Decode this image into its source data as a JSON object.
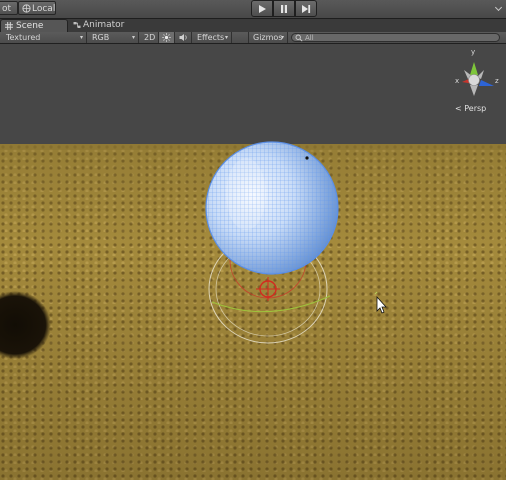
{
  "toolbar": {
    "pivot_fragment": "ot",
    "local_label": "Local",
    "play_icons": [
      "play-icon",
      "pause-icon",
      "step-icon"
    ]
  },
  "tabs": [
    {
      "label": "Scene",
      "icon": "scene-grid-icon",
      "active": true
    },
    {
      "label": "Animator",
      "icon": "animator-icon",
      "active": false
    }
  ],
  "scene_toolbar": {
    "draw_mode": "Textured",
    "render_mode": "RGB",
    "mode_2d": "2D",
    "lighting_icon": "sun-icon",
    "audio_icon": "speaker-icon",
    "effects_label": "Effects",
    "gizmos_label": "Gizmos",
    "search_placeholder": "All",
    "search_icon": "search-icon"
  },
  "scene_gizmo": {
    "axes": [
      "x",
      "y",
      "z"
    ],
    "projection_label": "Persp"
  },
  "colors": {
    "sky": "#474747",
    "ground": "#a48a3c",
    "sphere_wire": "#6aa2f0",
    "axis_x": "#c8342c",
    "axis_y": "#7ec63a",
    "axis_z": "#2d64d6"
  }
}
